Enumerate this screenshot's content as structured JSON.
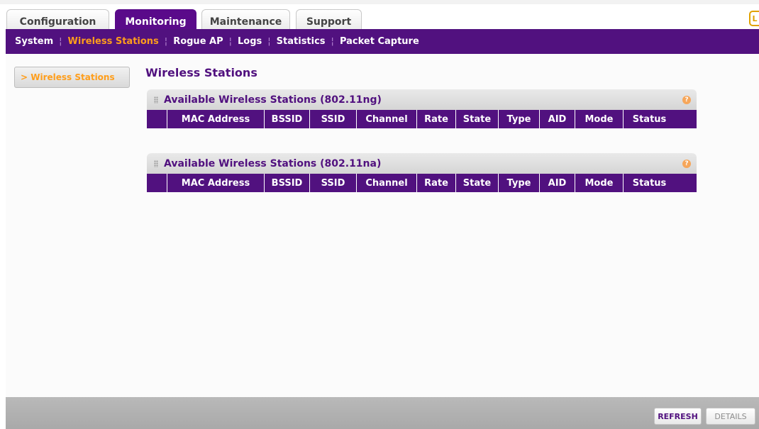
{
  "tabs": [
    {
      "label": "Configuration"
    },
    {
      "label": "Monitoring"
    },
    {
      "label": "Maintenance"
    },
    {
      "label": "Support"
    }
  ],
  "logout_label": "L",
  "subnav": [
    {
      "label": "System"
    },
    {
      "label": "Wireless Stations"
    },
    {
      "label": "Rogue AP"
    },
    {
      "label": "Logs"
    },
    {
      "label": "Statistics"
    },
    {
      "label": "Packet Capture"
    }
  ],
  "leftnav": {
    "label": "> Wireless Stations"
  },
  "page_title": "Wireless Stations",
  "panels": [
    {
      "title": "Available Wireless Stations (802.11ng)"
    },
    {
      "title": "Available Wireless Stations (802.11na)"
    }
  ],
  "help_label": "?",
  "columns": [
    "",
    "MAC Address",
    "BSSID",
    "SSID",
    "Channel",
    "Rate",
    "State",
    "Type",
    "AID",
    "Mode",
    "Status"
  ],
  "footer": {
    "refresh": "REFRESH",
    "details": "DETAILS"
  },
  "colors": {
    "brand_purple": "#51117f",
    "accent_orange": "#ff9e1b"
  }
}
